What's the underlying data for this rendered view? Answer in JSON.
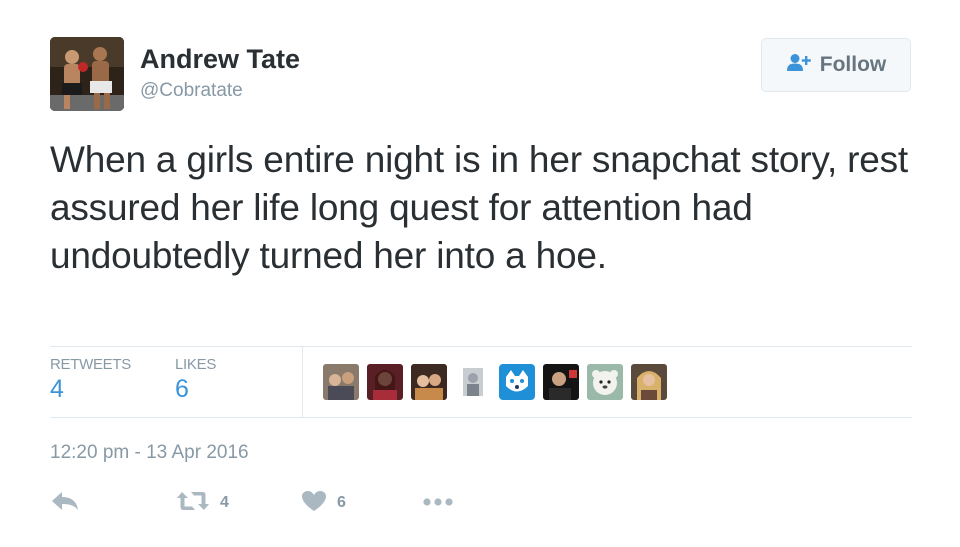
{
  "author": {
    "display_name": "Andrew Tate",
    "handle": "@Cobratate",
    "avatar_icon": "fighter-photo-avatar"
  },
  "follow_button": {
    "label": "Follow",
    "icon": "add-user-icon",
    "icon_color": "#3b94d9"
  },
  "tweet": {
    "text": "When a girls entire night is in her snapchat story, rest assured her life long quest for attention had undoubtedly turned her into a hoe."
  },
  "stats": {
    "retweets_label": "RETWEETS",
    "retweets_count": "4",
    "likes_label": "LIKES",
    "likes_count": "6"
  },
  "likers": [
    {
      "icon": "liker-avatar-1"
    },
    {
      "icon": "liker-avatar-2"
    },
    {
      "icon": "liker-avatar-3"
    },
    {
      "icon": "liker-avatar-4"
    },
    {
      "icon": "liker-avatar-5"
    },
    {
      "icon": "liker-avatar-6"
    },
    {
      "icon": "liker-avatar-7"
    },
    {
      "icon": "liker-avatar-8"
    }
  ],
  "timestamp": "12:20 pm - 13 Apr 2016",
  "actions": {
    "reply_icon": "reply-icon",
    "retweet_icon": "retweet-icon",
    "retweet_count": "4",
    "like_icon": "heart-icon",
    "like_count": "6",
    "more_icon": "more-dots-icon"
  },
  "colors": {
    "link_blue": "#3b94d9",
    "muted_gray": "#8899a6",
    "text_dark": "#292f33",
    "icon_gray": "#aab8c2"
  }
}
